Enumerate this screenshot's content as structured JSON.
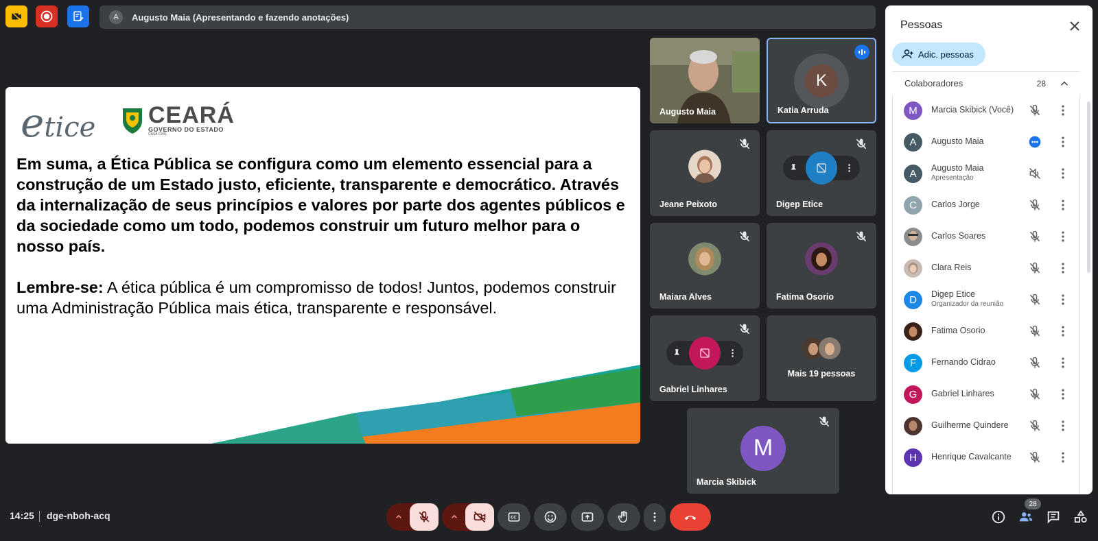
{
  "top": {
    "presenter_initial": "A",
    "presenter_text": "Augusto Maia (Apresentando e fazendo anotações)"
  },
  "slide": {
    "logo_etice_e": "e",
    "logo_etice_rest": "tice",
    "logo_ceara": "CEARÁ",
    "logo_gov": "GOVERNO DO ESTADO",
    "logo_casa": "CASA CIVIL",
    "paragraph1": "Em suma, a Ética Pública se configura como um elemento  essencial  para a construção  de  um  Estado  justo,  eficiente, transparente e democrático. Através da  internalização de seus princípios e valores por parte dos agentes públicos e da sociedade como um todo,  podemos construir um futuro melhor para o nosso país.",
    "paragraph2_bold": "Lembre-se:",
    "paragraph2_rest": " A ética pública é um compromisso de todos!  Juntos, podemos construir uma Administração Pública mais  ética, transparente e responsável."
  },
  "tiles": {
    "augusto": "Augusto Maia",
    "katia": "Katia Arruda",
    "katia_initial": "K",
    "jeane": "Jeane Peixoto",
    "digep": "Digep Etice",
    "maiara": "Maiara Alves",
    "fatima": "Fatima Osorio",
    "gabriel": "Gabriel Linhares",
    "more": "Mais 19 pessoas",
    "marcia": "Marcia Skibick",
    "marcia_initial": "M"
  },
  "panel": {
    "title": "Pessoas",
    "add_label": "Adic. pessoas",
    "section_label": "Colaboradores",
    "section_count": "28",
    "people": [
      {
        "initial": "M",
        "name": "Marcia Skibick (Você)",
        "sub": "",
        "color": "#7e57c2"
      },
      {
        "initial": "A",
        "name": "Augusto Maia",
        "sub": "",
        "color": "#455a64"
      },
      {
        "initial": "A",
        "name": "Augusto Maia",
        "sub": "Apresentação",
        "color": "#455a64"
      },
      {
        "initial": "C",
        "name": "Carlos Jorge",
        "sub": "",
        "color": "#90a4ae"
      },
      {
        "initial": "",
        "name": "Carlos Soares",
        "sub": "",
        "color": "#8d8d8d"
      },
      {
        "initial": "",
        "name": "Clara Reis",
        "sub": "",
        "color": "#b0a6a0"
      },
      {
        "initial": "D",
        "name": "Digep Etice",
        "sub": "Organizador da reunião",
        "color": "#1e88e5"
      },
      {
        "initial": "",
        "name": "Fatima Osorio",
        "sub": "",
        "color": "#5d3a2e"
      },
      {
        "initial": "F",
        "name": "Fernando Cidrao",
        "sub": "",
        "color": "#039be5"
      },
      {
        "initial": "G",
        "name": "Gabriel Linhares",
        "sub": "",
        "color": "#c2185b"
      },
      {
        "initial": "",
        "name": "Guilherme Quindere",
        "sub": "",
        "color": "#4e342e"
      },
      {
        "initial": "H",
        "name": "Henrique Cavalcante",
        "sub": "",
        "color": "#5e35b1"
      }
    ]
  },
  "bottom": {
    "time": "14:25",
    "meeting_code": "dge-nboh-acq",
    "people_badge": "28"
  }
}
